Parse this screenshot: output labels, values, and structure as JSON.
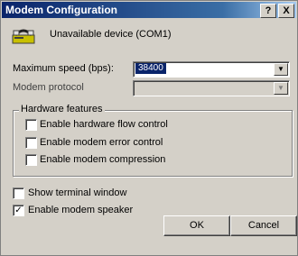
{
  "window": {
    "title": "Modem Configuration"
  },
  "title_buttons": {
    "help": "?",
    "close": "X"
  },
  "device": {
    "name": "Unavailable device (COM1)",
    "icon": "modem-icon"
  },
  "max_speed": {
    "label": "Maximum speed (bps):",
    "value": "38400"
  },
  "modem_protocol": {
    "label": "Modem protocol",
    "value": ""
  },
  "hardware_group": {
    "title": "Hardware features",
    "items": [
      {
        "label": "Enable hardware flow control",
        "checked": false
      },
      {
        "label": "Enable modem error control",
        "checked": false
      },
      {
        "label": "Enable modem compression",
        "checked": false
      }
    ]
  },
  "options": [
    {
      "label": "Show terminal window",
      "checked": false
    },
    {
      "label": "Enable modem speaker",
      "checked": true
    }
  ],
  "buttons": {
    "ok": "OK",
    "cancel": "Cancel"
  },
  "colors": {
    "titlebar_start": "#0a246a",
    "titlebar_end": "#a6caf0",
    "face": "#d4d0c8",
    "selection": "#0a246a"
  }
}
